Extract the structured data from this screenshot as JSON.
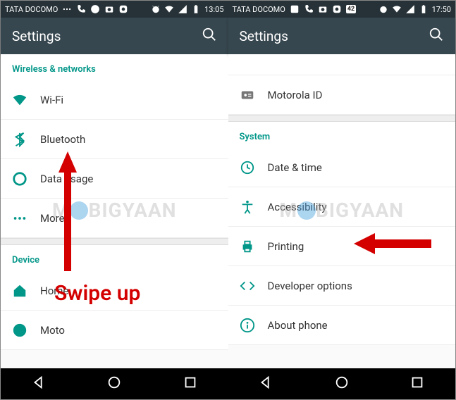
{
  "left": {
    "statusbar": {
      "carrier": "TATA DOCOMO",
      "time": "13:05"
    },
    "toolbar": {
      "title": "Settings"
    },
    "section1": {
      "header": "Wireless & networks"
    },
    "rows1": [
      {
        "label": "Wi-Fi"
      },
      {
        "label": "Bluetooth"
      },
      {
        "label": "Data usage"
      },
      {
        "label": "More"
      }
    ],
    "section2": {
      "header": "Device"
    },
    "rows2": [
      {
        "label": "Home"
      },
      {
        "label": "Moto"
      }
    ],
    "annotation": {
      "text": "Swipe up"
    }
  },
  "right": {
    "statusbar": {
      "carrier": "TATA DOCOMO",
      "badge": "42",
      "time": "17:50"
    },
    "toolbar": {
      "title": "Settings"
    },
    "rows_top": [
      {
        "label": "Motorola ID"
      }
    ],
    "section": {
      "header": "System"
    },
    "rows": [
      {
        "label": "Date & time"
      },
      {
        "label": "Accessibility"
      },
      {
        "label": "Printing"
      },
      {
        "label": "Developer options"
      },
      {
        "label": "About phone"
      }
    ]
  },
  "watermark": {
    "prefix": "M",
    "suffix": "BIGYAAN"
  }
}
